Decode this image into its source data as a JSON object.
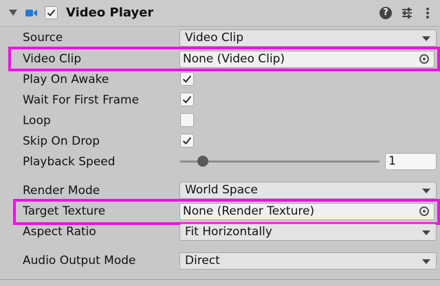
{
  "component": {
    "title": "Video Player",
    "icon": "video-camera-icon",
    "enabled": true,
    "header_buttons": [
      "help-icon",
      "presets-icon",
      "more-menu-icon"
    ]
  },
  "colors": {
    "highlight": "#f20ee8",
    "icon_blue": "#1f7ad6"
  },
  "fields": {
    "source": {
      "label": "Source",
      "value": "Video Clip"
    },
    "video_clip": {
      "label": "Video Clip",
      "value": "None (Video Clip)"
    },
    "play_on_awake": {
      "label": "Play On Awake",
      "checked": true
    },
    "wait_first_frame": {
      "label": "Wait For First Frame",
      "checked": true
    },
    "loop": {
      "label": "Loop",
      "checked": false
    },
    "skip_on_drop": {
      "label": "Skip On Drop",
      "checked": true
    },
    "playback_speed": {
      "label": "Playback Speed",
      "value": "1"
    },
    "render_mode": {
      "label": "Render Mode",
      "value": "World Space"
    },
    "target_texture": {
      "label": "Target Texture",
      "value": "None (Render Texture)"
    },
    "aspect_ratio": {
      "label": "Aspect Ratio",
      "value": "Fit Horizontally"
    },
    "audio_output_mode": {
      "label": "Audio Output Mode",
      "value": "Direct"
    }
  }
}
